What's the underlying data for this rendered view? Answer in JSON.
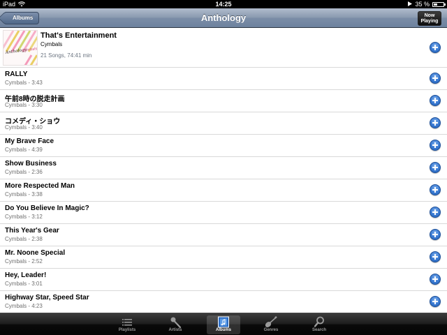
{
  "status_bar": {
    "carrier": "iPad",
    "time": "14:25",
    "battery": "35 %"
  },
  "nav": {
    "back_label": "Albums",
    "title": "Anthology",
    "now_playing_line1": "Now",
    "now_playing_line2": "Playing"
  },
  "album": {
    "title": "That's Entertainment",
    "artist": "Cymbals",
    "meta": "21 Songs, 74:41 min",
    "art_text": "Anthology Cymbals"
  },
  "tracks": [
    {
      "title": "RALLY",
      "sub": "Cymbals - 3:43"
    },
    {
      "title": "午前8時の脱走計画",
      "sub": "Cymbals - 3:30"
    },
    {
      "title": "コメディ・ショウ",
      "sub": "Cymbals - 3:40"
    },
    {
      "title": "My Brave Face",
      "sub": "Cymbals - 4:39"
    },
    {
      "title": "Show Business",
      "sub": "Cymbals - 2:36"
    },
    {
      "title": "More Respected Man",
      "sub": "Cymbals - 3:38"
    },
    {
      "title": "Do You Believe In Magic?",
      "sub": "Cymbals - 3:12"
    },
    {
      "title": "This Year's Gear",
      "sub": "Cymbals - 2:38"
    },
    {
      "title": "Mr. Noone Special",
      "sub": "Cymbals - 2:52"
    },
    {
      "title": "Hey, Leader!",
      "sub": "Cymbals - 3:01"
    },
    {
      "title": "Highway Star, Speed Star",
      "sub": "Cymbals - 4:23"
    }
  ],
  "tabs": [
    {
      "label": "Playlists",
      "icon": "playlists-icon",
      "selected": false
    },
    {
      "label": "Artists",
      "icon": "microphone-icon",
      "selected": false
    },
    {
      "label": "Albums",
      "icon": "album-icon",
      "selected": true
    },
    {
      "label": "Genres",
      "icon": "guitar-icon",
      "selected": false
    },
    {
      "label": "Search",
      "icon": "search-icon",
      "selected": false
    }
  ],
  "colors": {
    "nav_bar": "#7b8da7",
    "add_button": "#3a7ad2",
    "tab_bar": "#1c1c1c",
    "meta_text": "#6b7480"
  }
}
